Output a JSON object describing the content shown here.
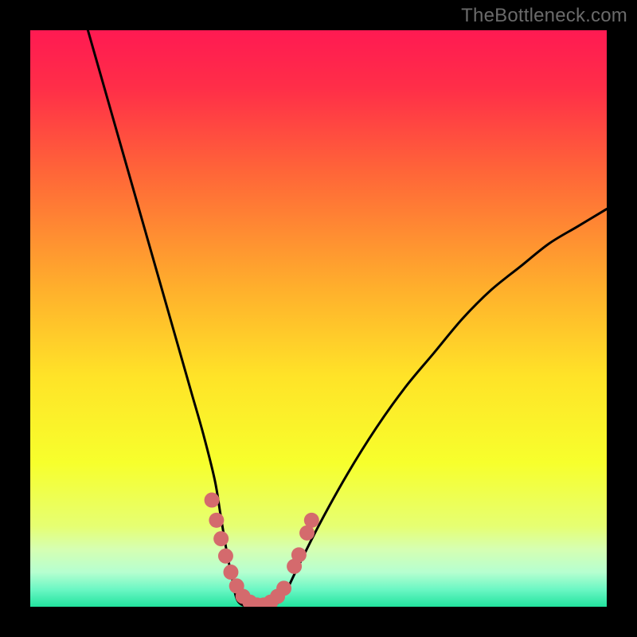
{
  "watermark": "TheBottleneck.com",
  "colors": {
    "frame": "#000000",
    "curve": "#000000",
    "marker": "#d46a6d",
    "gradient_stops": [
      {
        "offset": 0.0,
        "color": "#ff1a52"
      },
      {
        "offset": 0.1,
        "color": "#ff2e48"
      },
      {
        "offset": 0.25,
        "color": "#ff6738"
      },
      {
        "offset": 0.45,
        "color": "#ffb02c"
      },
      {
        "offset": 0.6,
        "color": "#ffe328"
      },
      {
        "offset": 0.75,
        "color": "#f7ff2c"
      },
      {
        "offset": 0.86,
        "color": "#e6ff72"
      },
      {
        "offset": 0.9,
        "color": "#d6ffb2"
      },
      {
        "offset": 0.94,
        "color": "#b6ffd0"
      },
      {
        "offset": 0.97,
        "color": "#6bf7c4"
      },
      {
        "offset": 1.0,
        "color": "#22e39e"
      }
    ]
  },
  "chart_data": {
    "type": "line",
    "title": "",
    "xlabel": "",
    "ylabel": "",
    "xlim": [
      0,
      100
    ],
    "ylim": [
      0,
      100
    ],
    "series": [
      {
        "name": "bottleneck-curve",
        "x": [
          10,
          12,
          14,
          16,
          18,
          20,
          22,
          24,
          26,
          28,
          30,
          32,
          33,
          34,
          35,
          36,
          38,
          40,
          42,
          44,
          46,
          50,
          55,
          60,
          65,
          70,
          75,
          80,
          85,
          90,
          95,
          100
        ],
        "y": [
          100,
          93,
          86,
          79,
          72,
          65,
          58,
          51,
          44,
          37,
          30,
          22,
          16,
          10,
          5,
          1,
          0,
          0,
          0,
          2,
          6,
          14,
          23,
          31,
          38,
          44,
          50,
          55,
          59,
          63,
          66,
          69
        ]
      }
    ],
    "markers": {
      "name": "highlight-markers",
      "x": [
        31.5,
        32.3,
        33.1,
        33.9,
        34.8,
        35.8,
        36.9,
        38.1,
        39.3,
        40.5,
        41.7,
        42.9,
        44.0,
        45.8,
        46.6,
        48.0,
        48.8
      ],
      "y": [
        18.5,
        15.0,
        11.8,
        8.8,
        6.0,
        3.6,
        1.8,
        0.8,
        0.3,
        0.3,
        0.8,
        1.8,
        3.2,
        7.0,
        9.0,
        12.8,
        15.0
      ]
    }
  }
}
